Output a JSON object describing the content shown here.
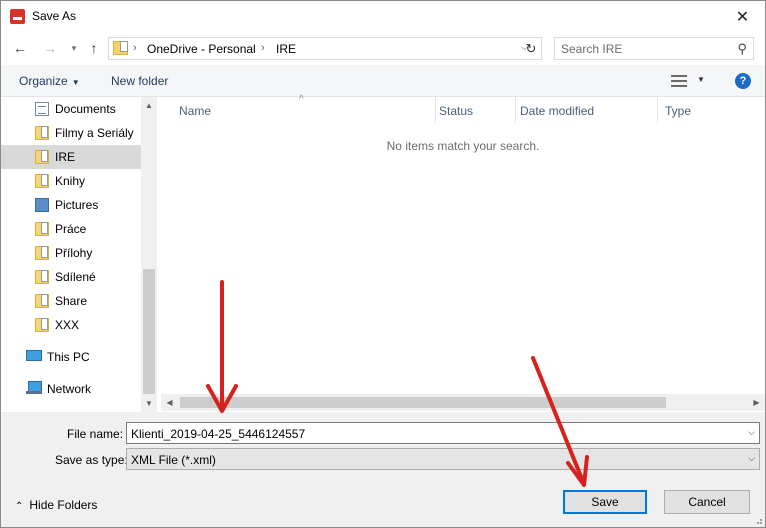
{
  "window": {
    "title": "Save As",
    "close_glyph": "✕"
  },
  "nav": {
    "back_glyph": "←",
    "forward_glyph": "→",
    "recent_glyph": "▾",
    "up_glyph": "↑",
    "address": {
      "segments": [
        "OneDrive - Personal",
        "IRE"
      ],
      "chevron": "›",
      "dropdown_glyph": "⌵"
    },
    "refresh_glyph": "↻",
    "search": {
      "placeholder": "Search IRE",
      "icon_glyph": "⚲"
    }
  },
  "toolbar": {
    "organize_label": "Organize",
    "caret": "▼",
    "new_folder_label": "New folder",
    "help_label": "?"
  },
  "sidebar": {
    "items": [
      {
        "label": "Documents",
        "icon": "documents-icon"
      },
      {
        "label": "Filmy a Seriály",
        "icon": "folder-icon"
      },
      {
        "label": "IRE",
        "icon": "folder-icon",
        "selected": true
      },
      {
        "label": "Knihy",
        "icon": "folder-icon"
      },
      {
        "label": "Pictures",
        "icon": "pictures-icon"
      },
      {
        "label": "Práce",
        "icon": "folder-icon"
      },
      {
        "label": "Přílohy",
        "icon": "folder-icon"
      },
      {
        "label": "Sdílené",
        "icon": "folder-icon"
      },
      {
        "label": "Share",
        "icon": "folder-icon"
      },
      {
        "label": "XXX",
        "icon": "folder-icon"
      }
    ],
    "this_pc": "This PC",
    "network": "Network",
    "scroll_up": "▲",
    "scroll_down": "▼"
  },
  "filelist": {
    "columns": [
      "Name",
      "Status",
      "Date modified",
      "Type"
    ],
    "sort_glyph": "^",
    "empty_message": "No items match your search.",
    "scroll_left": "◀",
    "scroll_right": "▶"
  },
  "form": {
    "file_name_label": "File name:",
    "file_name_value": "Klienti_2019-04-25_5446124557",
    "save_as_type_label": "Save as type:",
    "save_as_type_value": "XML File (*.xml)",
    "dropdown_glyph": "⌵"
  },
  "footer": {
    "hide_folders_label": "Hide Folders",
    "hide_caret": "⌃",
    "save_label": "Save",
    "cancel_label": "Cancel"
  },
  "colors": {
    "accent": "#0078d7",
    "annotation_arrow": "#d4231d",
    "app_icon": "#d8332a"
  }
}
